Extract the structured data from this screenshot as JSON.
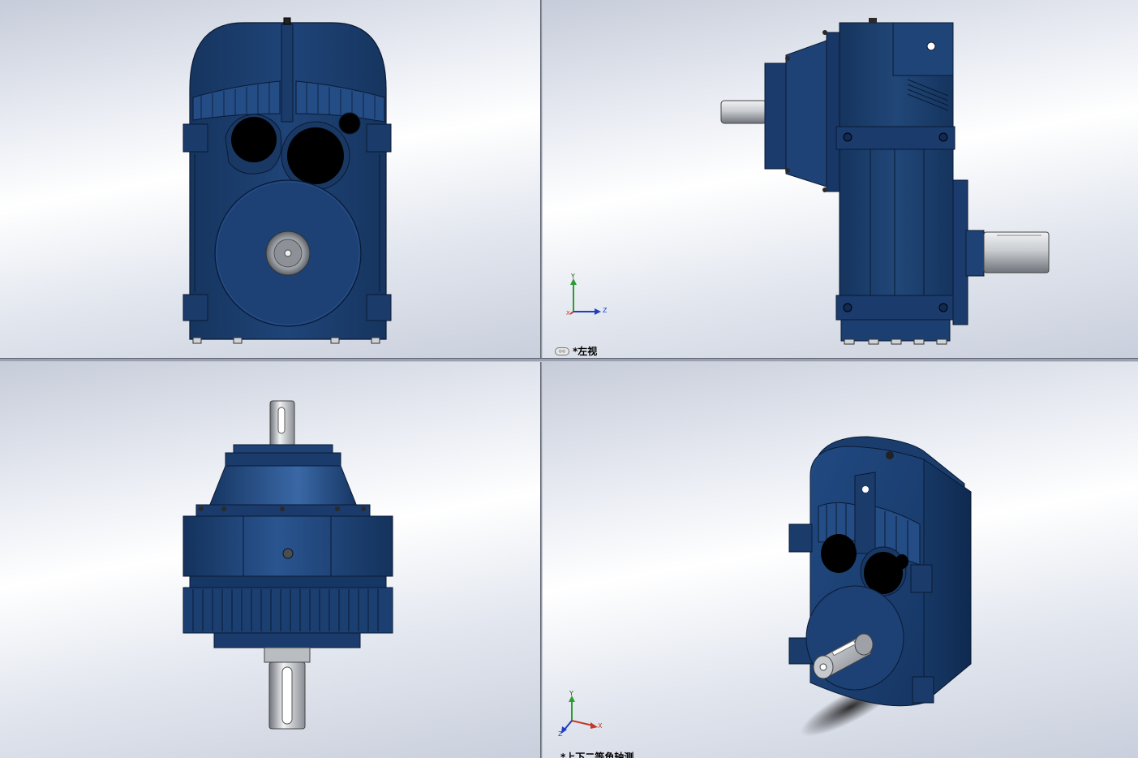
{
  "viewports": {
    "top_right": {
      "label": "*左视",
      "label_icon": "view-orientation-icon",
      "triad": {
        "x": "X",
        "y": "Y",
        "z": "Z"
      }
    },
    "bottom_right": {
      "label": "*上下二等角轴测",
      "triad": {
        "x": "X",
        "y": "Y",
        "z": "Z"
      }
    }
  },
  "colors": {
    "housing": "#1c3f72",
    "housing_dark": "#0e2447",
    "shaft": "#b9bcc1",
    "hole": "#000000",
    "axis_x": "#c0392b",
    "axis_y": "#2e9b33",
    "axis_z": "#1f3fbf"
  }
}
